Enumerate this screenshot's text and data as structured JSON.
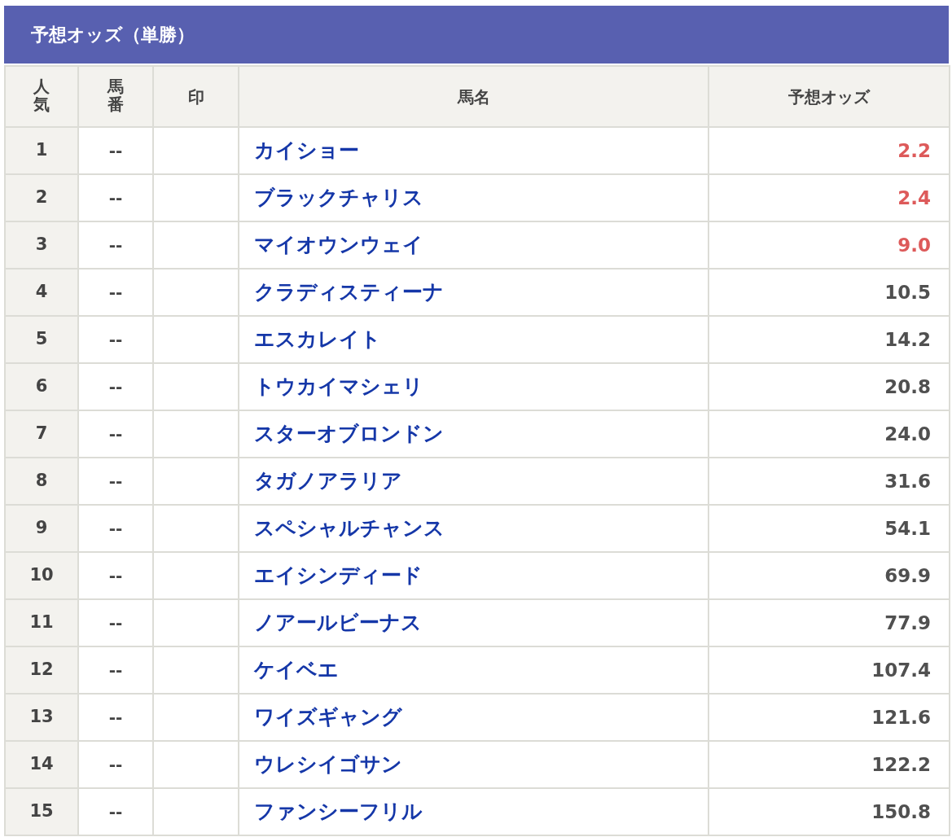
{
  "title": "予想オッズ（単勝）",
  "columns": [
    "人気",
    "馬番",
    "印",
    "馬名",
    "予想オッズ"
  ],
  "rows": [
    {
      "rank": "1",
      "number": "--",
      "name": "カイショー",
      "odds": "2.2",
      "favorite": true
    },
    {
      "rank": "2",
      "number": "--",
      "name": "ブラックチャリス",
      "odds": "2.4",
      "favorite": true
    },
    {
      "rank": "3",
      "number": "--",
      "name": "マイオウンウェイ",
      "odds": "9.0",
      "favorite": true
    },
    {
      "rank": "4",
      "number": "--",
      "name": "クラディスティーナ",
      "odds": "10.5",
      "favorite": false
    },
    {
      "rank": "5",
      "number": "--",
      "name": "エスカレイト",
      "odds": "14.2",
      "favorite": false
    },
    {
      "rank": "6",
      "number": "--",
      "name": "トウカイマシェリ",
      "odds": "20.8",
      "favorite": false
    },
    {
      "rank": "7",
      "number": "--",
      "name": "スターオブロンドン",
      "odds": "24.0",
      "favorite": false
    },
    {
      "rank": "8",
      "number": "--",
      "name": "タガノアラリア",
      "odds": "31.6",
      "favorite": false
    },
    {
      "rank": "9",
      "number": "--",
      "name": "スペシャルチャンス",
      "odds": "54.1",
      "favorite": false
    },
    {
      "rank": "10",
      "number": "--",
      "name": "エイシンディード",
      "odds": "69.9",
      "favorite": false
    },
    {
      "rank": "11",
      "number": "--",
      "name": "ノアールビーナス",
      "odds": "77.9",
      "favorite": false
    },
    {
      "rank": "12",
      "number": "--",
      "name": "ケイベエ",
      "odds": "107.4",
      "favorite": false
    },
    {
      "rank": "13",
      "number": "--",
      "name": "ワイズギャング",
      "odds": "121.6",
      "favorite": false
    },
    {
      "rank": "14",
      "number": "--",
      "name": "ウレシイゴサン",
      "odds": "122.2",
      "favorite": false
    },
    {
      "rank": "15",
      "number": "--",
      "name": "ファンシーフリル",
      "odds": "150.8",
      "favorite": false
    }
  ]
}
